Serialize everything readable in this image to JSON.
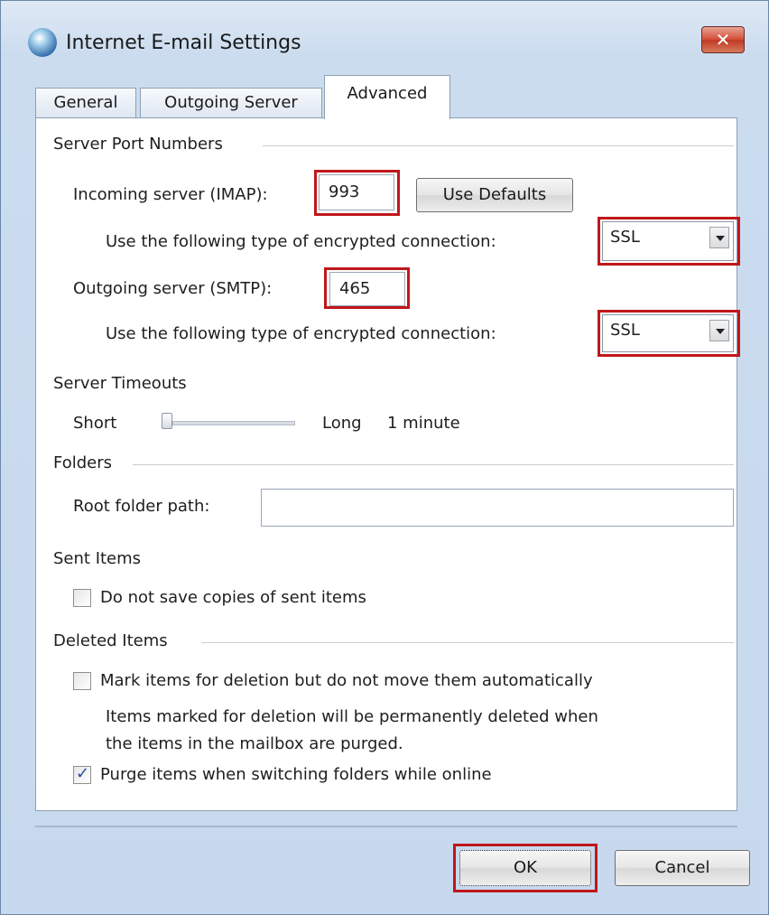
{
  "window": {
    "title": "Internet E-mail Settings",
    "close_label": "✕"
  },
  "tabs": [
    {
      "label": "General",
      "active": false
    },
    {
      "label": "Outgoing Server",
      "active": false
    },
    {
      "label": "Advanced",
      "active": true
    }
  ],
  "server_ports": {
    "group_label": "Server Port Numbers",
    "incoming_label": "Incoming server (IMAP):",
    "incoming_value": "993",
    "use_defaults_label": "Use Defaults",
    "incoming_encryption_label": "Use the following type of encrypted connection:",
    "incoming_encryption_value": "SSL",
    "outgoing_label": "Outgoing server (SMTP):",
    "outgoing_value": "465",
    "outgoing_encryption_label": "Use the following type of encrypted connection:",
    "outgoing_encryption_value": "SSL"
  },
  "timeouts": {
    "group_label": "Server Timeouts",
    "short_label": "Short",
    "long_label": "Long",
    "value_text": "1 minute"
  },
  "folders": {
    "group_label": "Folders",
    "root_folder_label": "Root folder path:",
    "root_folder_value": ""
  },
  "sent_items": {
    "group_label": "Sent Items",
    "dont_save_label": "Do not save copies of sent items",
    "dont_save_checked": false
  },
  "deleted_items": {
    "group_label": "Deleted Items",
    "mark_label": "Mark items for deletion but do not move them automatically",
    "mark_checked": false,
    "note_line1": "Items marked for deletion will be permanently deleted when",
    "note_line2": "the items in the mailbox are purged.",
    "purge_label": "Purge items when switching folders while online",
    "purge_checked": true
  },
  "footer": {
    "ok_label": "OK",
    "cancel_label": "Cancel"
  },
  "colors": {
    "highlight": "#c0171b",
    "accent": "#254f9c"
  }
}
